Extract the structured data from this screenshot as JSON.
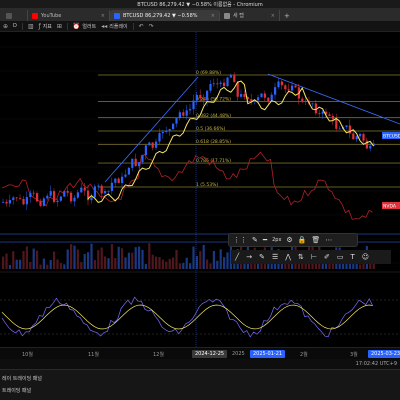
{
  "window": {
    "title": "BTCUSD 86,279.42 ▼ −0.58% 이름없음 - Chromium"
  },
  "tabs": [
    {
      "label": "",
      "color": "#555555"
    },
    {
      "label": "YouTube",
      "color": "#ff0000"
    },
    {
      "label": "BTCUSD 86,279.42 ▼ −0.58%",
      "color": "#2962ff"
    },
    {
      "label": "새 탭",
      "color": "#888888"
    }
  ],
  "toolbar": {
    "interval": "D",
    "indicators_label": "지표",
    "alert_label": "얼러트",
    "replay_label": "리플레이"
  },
  "fib_levels": [
    {
      "label": "0 (69.88%)",
      "value": 0
    },
    {
      "label": "0.236 (56.72%)",
      "value": 0.236
    },
    {
      "label": "0.382 (44.48%)",
      "value": 0.382
    },
    {
      "label": "0.5 (36.66%)",
      "value": 0.5
    },
    {
      "label": "0.618 (28.85%)",
      "value": 0.618
    },
    {
      "label": "0.786 (17.71%)",
      "value": 0.786
    },
    {
      "label": "1 (5.53%)",
      "value": 1
    }
  ],
  "price_tags": {
    "btc": "BTCUSD",
    "nvda": "NVDA"
  },
  "drawing_toolbar": {
    "width_label": "2px"
  },
  "date_axis": {
    "labels": [
      "10월",
      "11월",
      "12월",
      "2025",
      "2월",
      "3월"
    ],
    "tags": {
      "cursor": "2024-12-25",
      "start": "2025-01-21",
      "end": "2025-03-23"
    }
  },
  "status": {
    "clock": "17:02:42 UTC+9"
  },
  "footer": {
    "left_a": "레이 트레이딩 패널",
    "left_b": "트레이딩 패널"
  },
  "colors": {
    "bull": "#2962ff",
    "bear": "#e0303a",
    "ma": "#f5e663",
    "fib": "#c9b84a",
    "nvda": "#b0202a",
    "trend": "#3b6dff",
    "osc": "#7a6cff"
  }
}
